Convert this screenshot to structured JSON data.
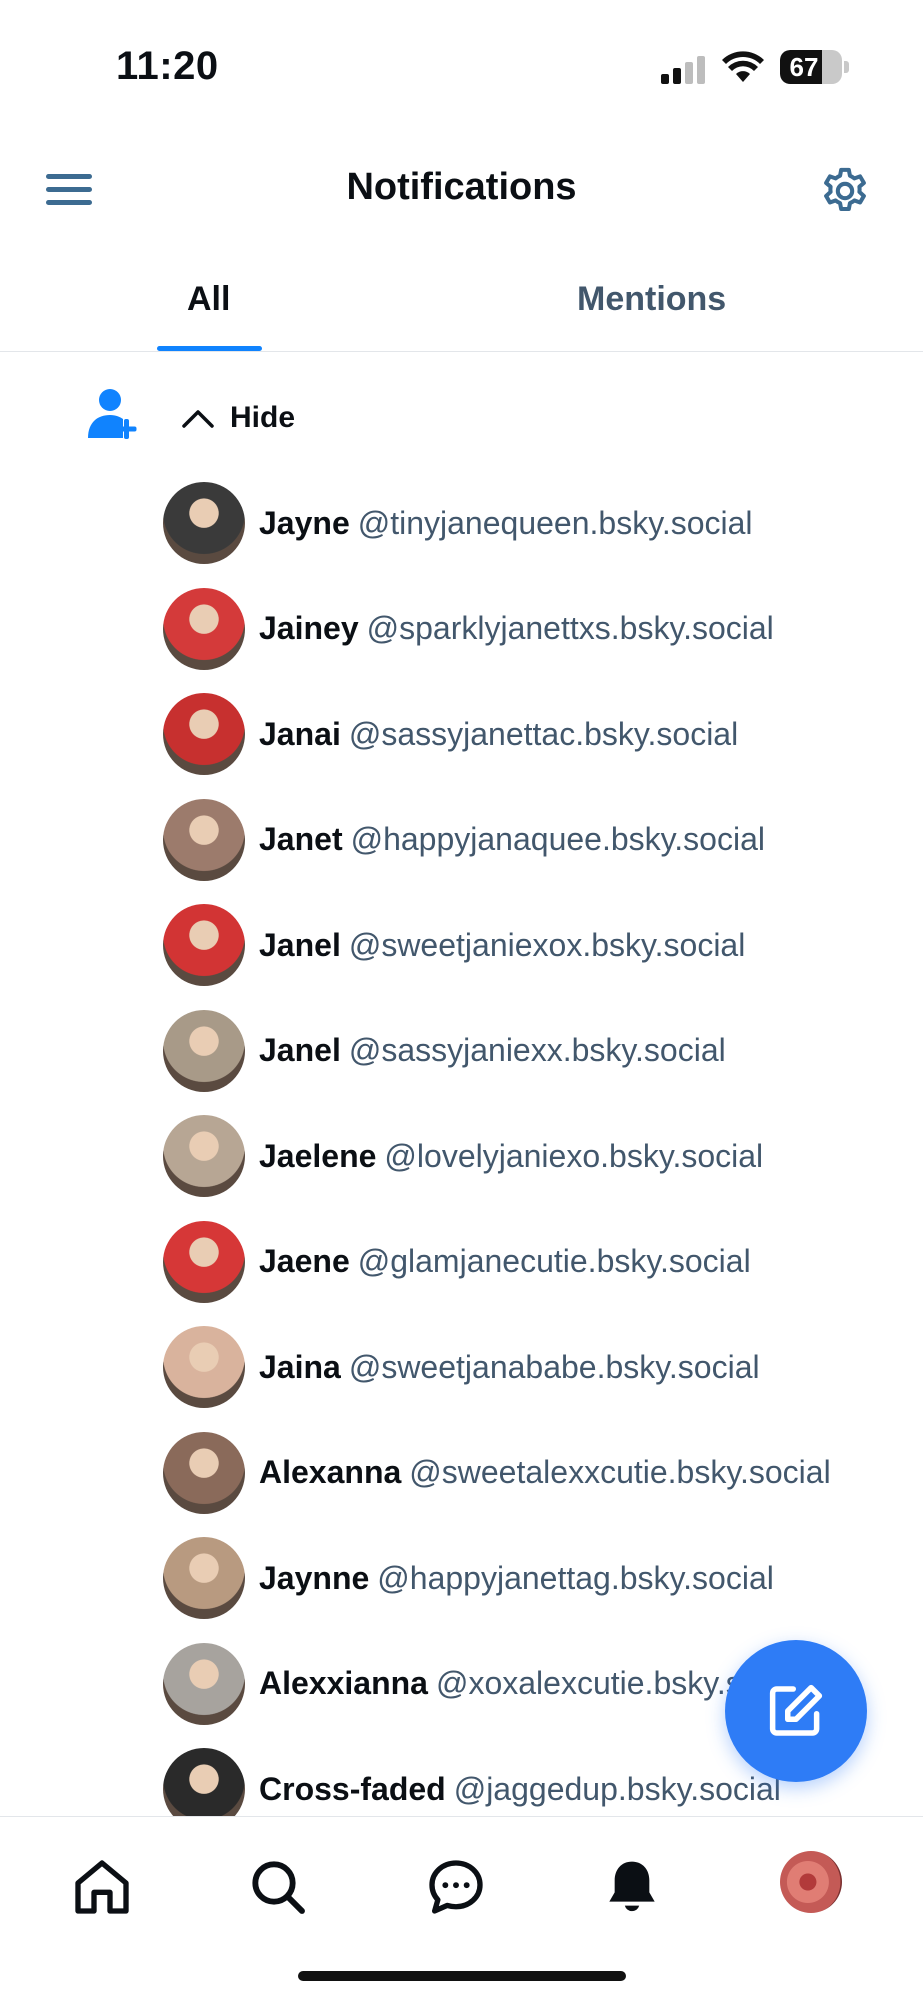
{
  "status_bar": {
    "time": "11:20",
    "battery_percent": "67",
    "battery_level": 0.67
  },
  "header": {
    "title": "Notifications",
    "menu_icon": "hamburger-menu-icon",
    "settings_icon": "gear-icon"
  },
  "tabs": [
    {
      "label": "All",
      "selected": true
    },
    {
      "label": "Mentions",
      "selected": false
    }
  ],
  "follow_group": {
    "icon": "person-plus-icon",
    "toggle_label": "Hide",
    "users": [
      {
        "name": "Jayne",
        "handle": "@tinyjanequeen.bsky.social",
        "avatar_color": "#3a3a3a"
      },
      {
        "name": "Jainey",
        "handle": "@sparklyjanettxs.bsky.social",
        "avatar_color": "#d43a3a"
      },
      {
        "name": "Janai",
        "handle": "@sassyjanettac.bsky.social",
        "avatar_color": "#c7302f"
      },
      {
        "name": "Janet",
        "handle": "@happyjanaquee.bsky.social",
        "avatar_color": "#9c7b6c"
      },
      {
        "name": "Janel",
        "handle": "@sweetjaniexox.bsky.social",
        "avatar_color": "#d23434"
      },
      {
        "name": "Janel",
        "handle": "@sassyjaniexx.bsky.social",
        "avatar_color": "#a89a88"
      },
      {
        "name": "Jaelene",
        "handle": "@lovelyjaniexo.bsky.social",
        "avatar_color": "#b7a694"
      },
      {
        "name": "Jaene",
        "handle": "@glamjanecutie.bsky.social",
        "avatar_color": "#d63737"
      },
      {
        "name": "Jaina",
        "handle": "@sweetjanababe.bsky.social",
        "avatar_color": "#d9b39d"
      },
      {
        "name": "Alexanna",
        "handle": "@sweetalexxcutie.bsky.social",
        "avatar_color": "#8a6a5a"
      },
      {
        "name": "Jaynne",
        "handle": "@happyjanettag.bsky.social",
        "avatar_color": "#b89a80"
      },
      {
        "name": "Alexxianna",
        "handle": "@xoxalexcutie.bsky.social",
        "avatar_color": "#a7a39e"
      },
      {
        "name": "Cross-faded",
        "handle": "@jaggedup.bsky.social",
        "avatar_color": "#2a2a2a"
      }
    ]
  },
  "fab": {
    "icon": "compose-icon"
  },
  "bottom_nav": [
    {
      "icon": "home-icon"
    },
    {
      "icon": "search-icon"
    },
    {
      "icon": "chat-icon"
    },
    {
      "icon": "bell-icon",
      "active": true
    },
    {
      "icon": "profile-avatar"
    }
  ],
  "colors": {
    "accent": "#1083fe",
    "fab": "#2e7cf6",
    "icon_blue": "#3c6b91",
    "handle_text": "#42576c"
  }
}
